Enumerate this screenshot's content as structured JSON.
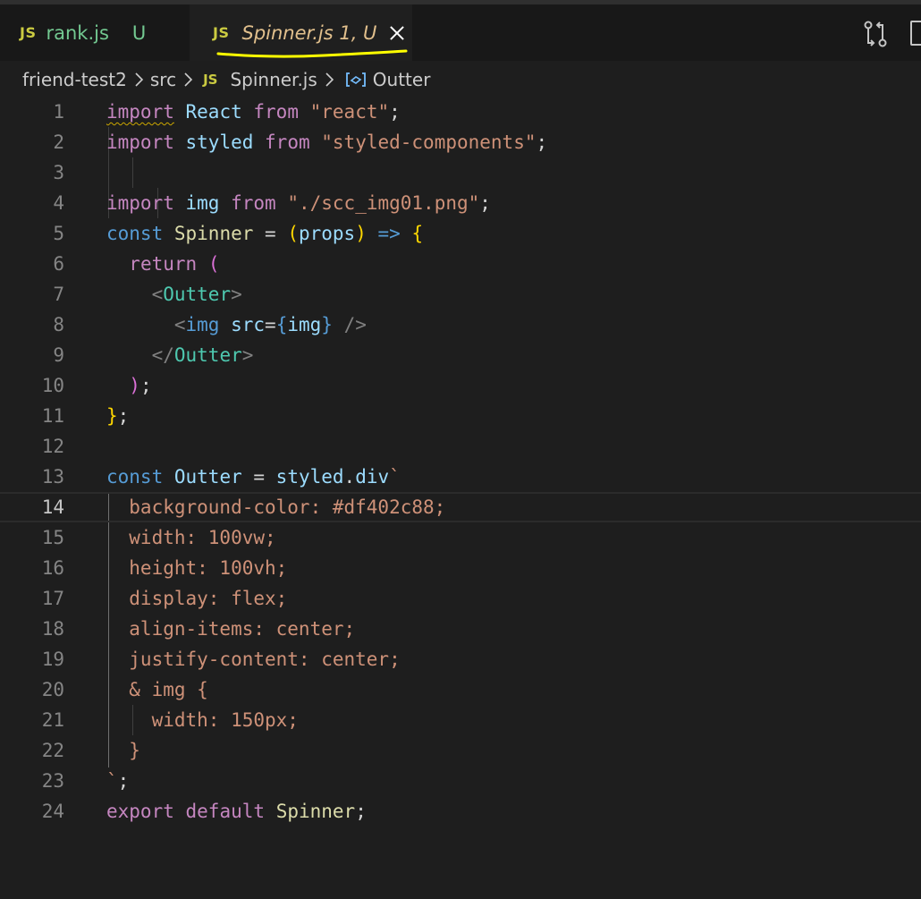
{
  "tabs": [
    {
      "badge": "JS",
      "name": "rank.js",
      "status": "U"
    },
    {
      "badge": "JS",
      "name": "Spinner.js 1, U"
    }
  ],
  "breadcrumb": {
    "project": "friend-test2",
    "folder": "src",
    "file_badge": "JS",
    "file": "Spinner.js",
    "symbol": "Outter"
  },
  "editor": {
    "current_line": 14,
    "lines": [
      {
        "n": "1",
        "tokens": [
          [
            "kw squiggle",
            "import"
          ],
          [
            "punc",
            " "
          ],
          [
            "var",
            "React"
          ],
          [
            "punc",
            " "
          ],
          [
            "kw",
            "from"
          ],
          [
            "punc",
            " "
          ],
          [
            "str",
            "\"react\""
          ],
          [
            "punc",
            ";"
          ]
        ]
      },
      {
        "n": "2",
        "tokens": [
          [
            "kw",
            "import"
          ],
          [
            "punc",
            " "
          ],
          [
            "var",
            "styled"
          ],
          [
            "punc",
            " "
          ],
          [
            "kw",
            "from"
          ],
          [
            "punc",
            " "
          ],
          [
            "str",
            "\"styled-components\""
          ],
          [
            "punc",
            ";"
          ]
        ]
      },
      {
        "n": "3",
        "tokens": []
      },
      {
        "n": "4",
        "tokens": [
          [
            "kw",
            "import"
          ],
          [
            "punc",
            " "
          ],
          [
            "var",
            "img"
          ],
          [
            "punc",
            " "
          ],
          [
            "kw",
            "from"
          ],
          [
            "punc",
            " "
          ],
          [
            "str",
            "\"./scc_img01.png\""
          ],
          [
            "punc",
            ";"
          ]
        ]
      },
      {
        "n": "5",
        "tokens": [
          [
            "kwb",
            "const"
          ],
          [
            "punc",
            " "
          ],
          [
            "fn",
            "Spinner"
          ],
          [
            "punc",
            " = "
          ],
          [
            "brk",
            "("
          ],
          [
            "var",
            "props"
          ],
          [
            "brk",
            ")"
          ],
          [
            "punc",
            " "
          ],
          [
            "kwb",
            "=>"
          ],
          [
            "punc",
            " "
          ],
          [
            "brk",
            "{"
          ]
        ]
      },
      {
        "n": "6",
        "tokens": [
          [
            "punc",
            "  "
          ],
          [
            "kw",
            "return"
          ],
          [
            "punc",
            " "
          ],
          [
            "brk2",
            "("
          ]
        ]
      },
      {
        "n": "7",
        "tokens": [
          [
            "punc",
            "    "
          ],
          [
            "tag",
            "<"
          ],
          [
            "cls",
            "Outter"
          ],
          [
            "tag",
            ">"
          ]
        ]
      },
      {
        "n": "8",
        "tokens": [
          [
            "punc",
            "      "
          ],
          [
            "tag",
            "<"
          ],
          [
            "kwb",
            "img"
          ],
          [
            "punc",
            " "
          ],
          [
            "var",
            "src"
          ],
          [
            "punc",
            "="
          ],
          [
            "kwb",
            "{"
          ],
          [
            "var",
            "img"
          ],
          [
            "kwb",
            "}"
          ],
          [
            "punc",
            " "
          ],
          [
            "tag",
            "/>"
          ]
        ]
      },
      {
        "n": "9",
        "tokens": [
          [
            "punc",
            "    "
          ],
          [
            "tag",
            "</"
          ],
          [
            "cls",
            "Outter"
          ],
          [
            "tag",
            ">"
          ]
        ]
      },
      {
        "n": "10",
        "tokens": [
          [
            "punc",
            "  "
          ],
          [
            "brk2",
            ")"
          ],
          [
            "punc",
            ";"
          ]
        ]
      },
      {
        "n": "11",
        "tokens": [
          [
            "brk",
            "}"
          ],
          [
            "punc",
            ";"
          ]
        ]
      },
      {
        "n": "12",
        "tokens": []
      },
      {
        "n": "13",
        "tokens": [
          [
            "kwb",
            "const"
          ],
          [
            "punc",
            " "
          ],
          [
            "var",
            "Outter"
          ],
          [
            "punc",
            " = "
          ],
          [
            "var",
            "styled"
          ],
          [
            "punc",
            "."
          ],
          [
            "var",
            "div"
          ],
          [
            "css",
            "`"
          ]
        ]
      },
      {
        "n": "14",
        "tokens": [
          [
            "css",
            "  background-color: #df402c88;"
          ]
        ]
      },
      {
        "n": "15",
        "tokens": [
          [
            "css",
            "  width: 100vw;"
          ]
        ]
      },
      {
        "n": "16",
        "tokens": [
          [
            "css",
            "  height: 100vh;"
          ]
        ]
      },
      {
        "n": "17",
        "tokens": [
          [
            "css",
            "  display: flex;"
          ]
        ]
      },
      {
        "n": "18",
        "tokens": [
          [
            "css",
            "  align-items: center;"
          ]
        ]
      },
      {
        "n": "19",
        "tokens": [
          [
            "css",
            "  justify-content: center;"
          ]
        ]
      },
      {
        "n": "20",
        "tokens": [
          [
            "css",
            "  & img {"
          ]
        ]
      },
      {
        "n": "21",
        "tokens": [
          [
            "css",
            "    width: 150px;"
          ]
        ]
      },
      {
        "n": "22",
        "tokens": [
          [
            "css",
            "  }"
          ]
        ]
      },
      {
        "n": "23",
        "tokens": [
          [
            "css",
            "`"
          ],
          [
            "punc",
            ";"
          ]
        ]
      },
      {
        "n": "24",
        "tokens": [
          [
            "kw",
            "export"
          ],
          [
            "punc",
            " "
          ],
          [
            "kw",
            "default"
          ],
          [
            "punc",
            " "
          ],
          [
            "fn",
            "Spinner"
          ],
          [
            "punc",
            ";"
          ]
        ]
      }
    ]
  },
  "colors": {
    "accent_underline": "#ffff00",
    "untracked_green": "#73c991",
    "modified_tab": "#e2c08d",
    "js_badge": "#cbcb41"
  }
}
